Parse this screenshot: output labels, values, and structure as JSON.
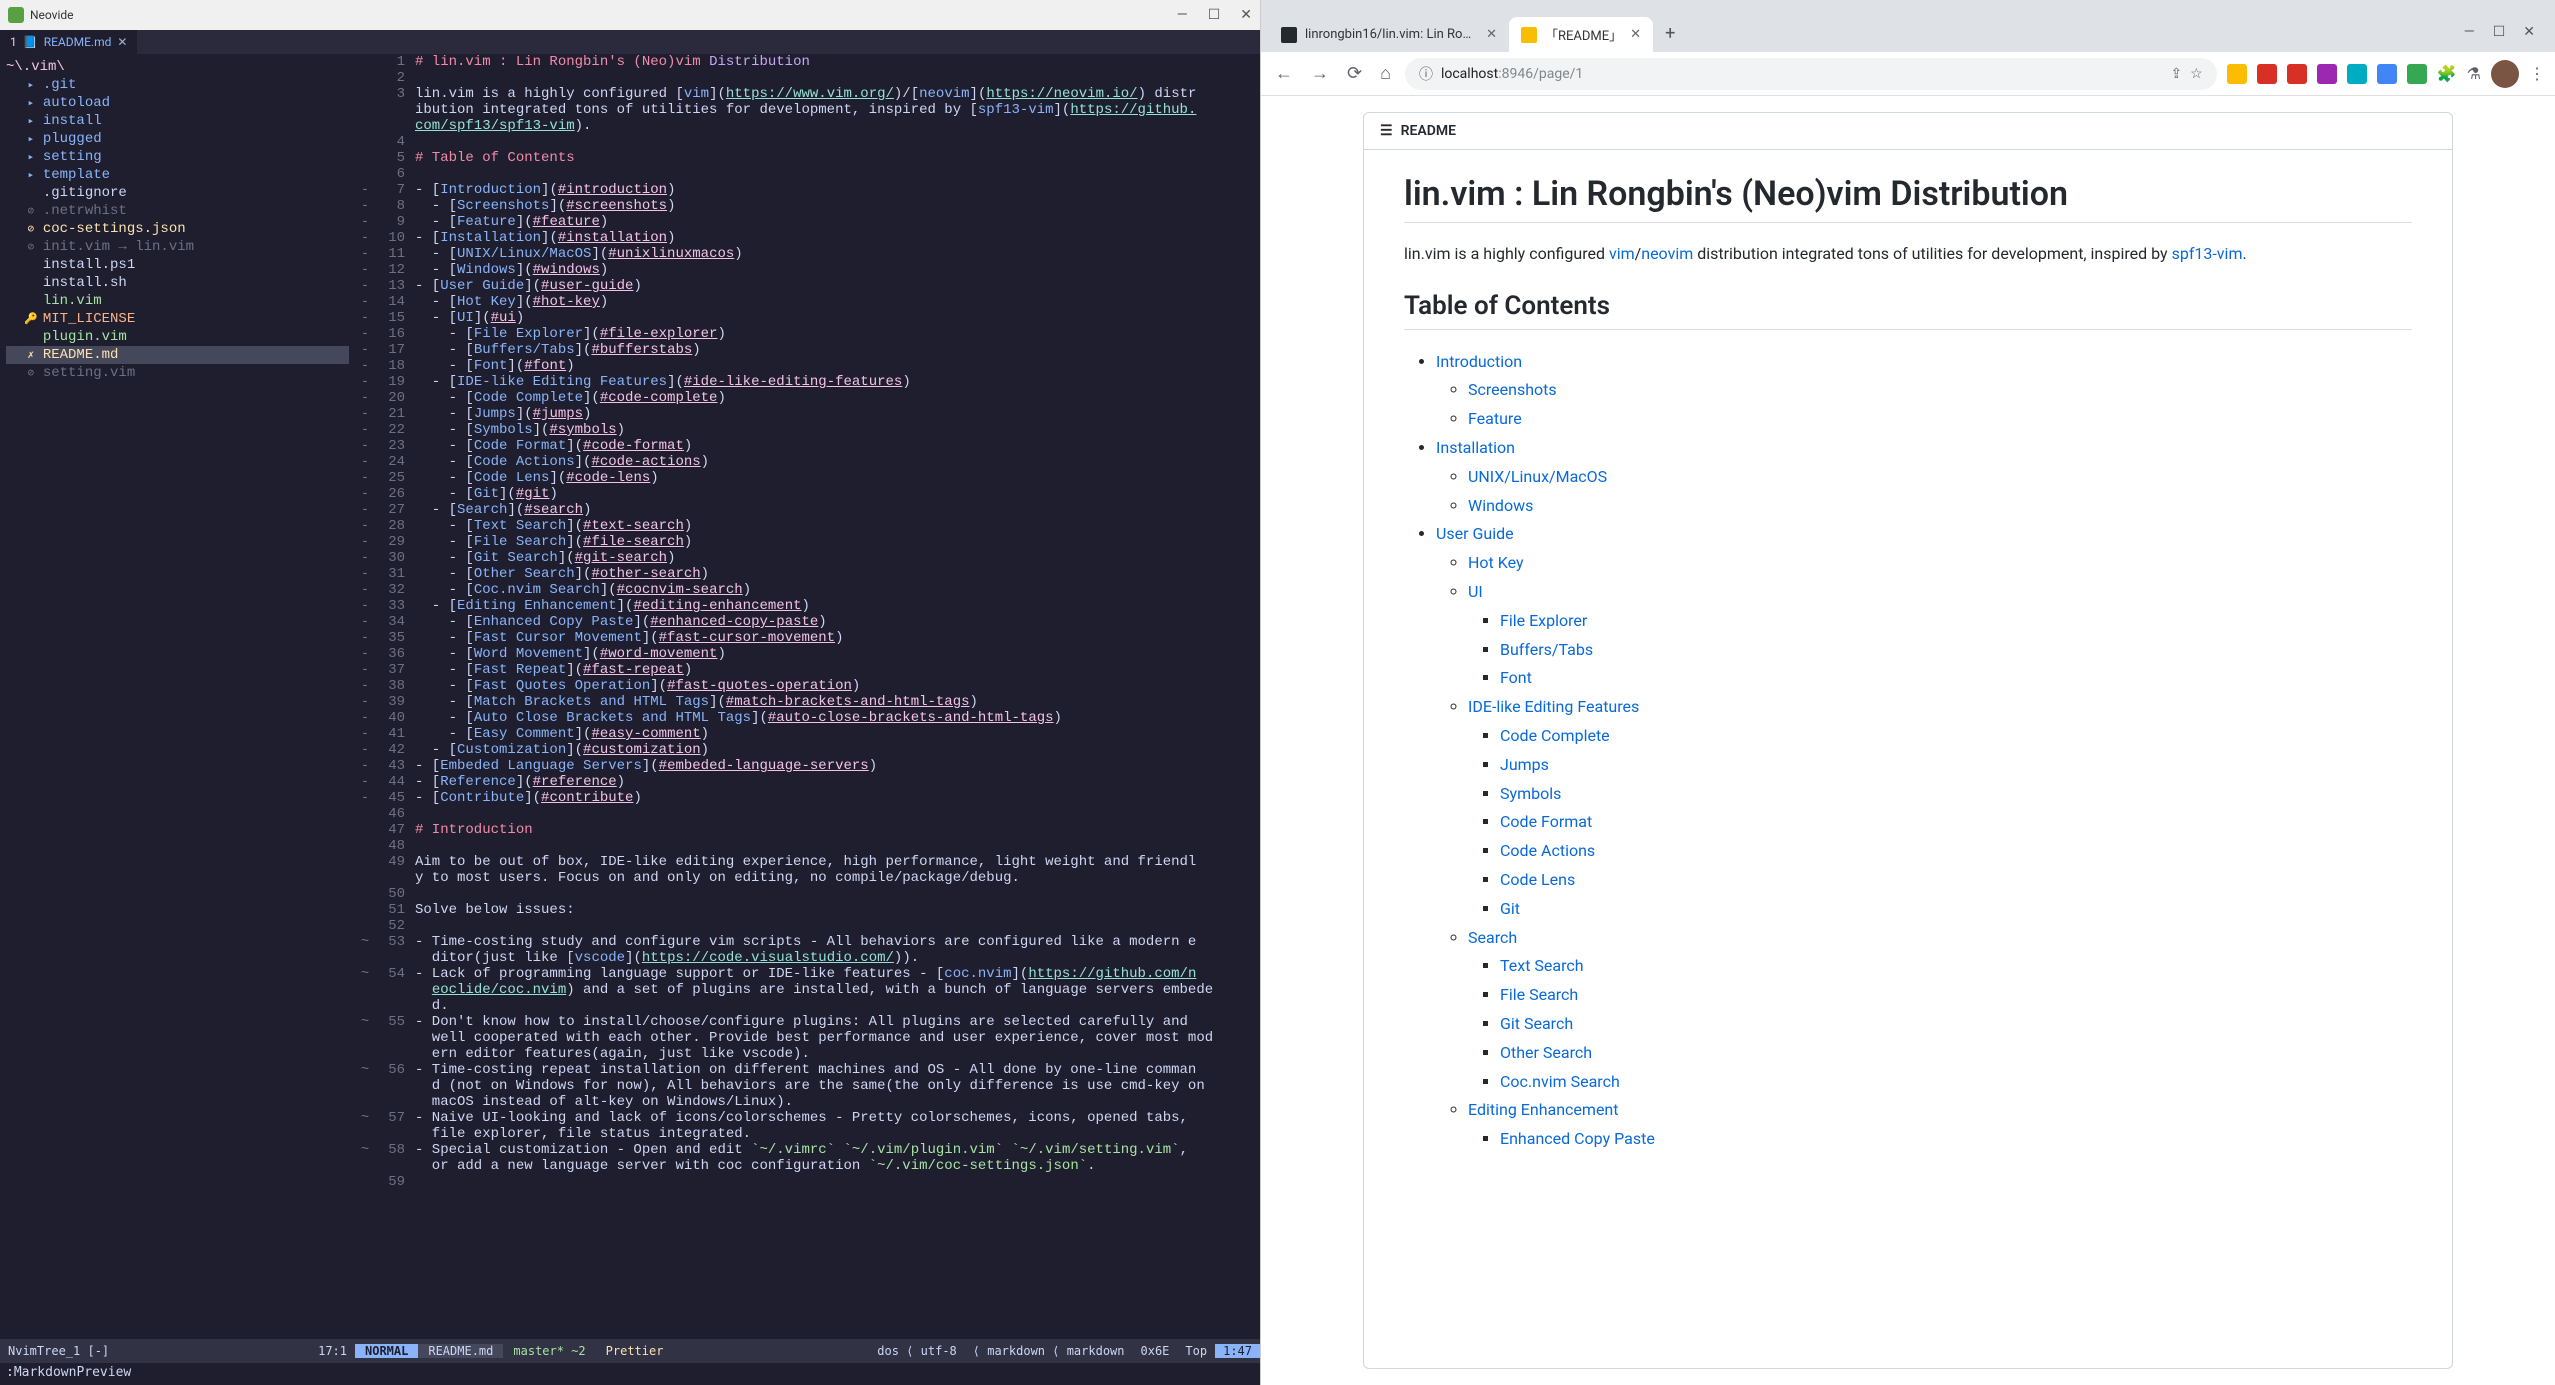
{
  "neovide": {
    "title": "Neovide",
    "tab": {
      "num": "1",
      "name": "README.md"
    },
    "tree": {
      "root": "~\\.vim\\",
      "items": [
        {
          "indent": 1,
          "icon": "▸",
          "name": ".git",
          "cls": "tree-folder"
        },
        {
          "indent": 1,
          "icon": "▸",
          "name": "autoload",
          "cls": "tree-folder"
        },
        {
          "indent": 1,
          "icon": "▸",
          "name": "install",
          "cls": "tree-folder"
        },
        {
          "indent": 1,
          "icon": "▸",
          "name": "plugged",
          "cls": "tree-folder"
        },
        {
          "indent": 1,
          "icon": "▸",
          "name": "setting",
          "cls": "tree-folder"
        },
        {
          "indent": 1,
          "icon": "▸",
          "name": "template",
          "cls": "tree-folder"
        },
        {
          "indent": 1,
          "icon": " ",
          "name": ".gitignore",
          "cls": "tree-file"
        },
        {
          "indent": 1,
          "icon": "⊘",
          "name": ".netrwhist",
          "cls": "tree-dim"
        },
        {
          "indent": 1,
          "icon": "⊘",
          "name": "coc-settings.json",
          "cls": "tree-json"
        },
        {
          "indent": 1,
          "icon": "⊘",
          "name": "init.vim → lin.vim",
          "cls": "tree-dim"
        },
        {
          "indent": 1,
          "icon": " ",
          "name": "install.ps1",
          "cls": "tree-file"
        },
        {
          "indent": 1,
          "icon": " ",
          "name": "install.sh",
          "cls": "tree-file"
        },
        {
          "indent": 1,
          "icon": " ",
          "name": "lin.vim",
          "cls": "tree-vim"
        },
        {
          "indent": 1,
          "icon": "🔑",
          "name": "MIT_LICENSE",
          "cls": "tree-license"
        },
        {
          "indent": 1,
          "icon": " ",
          "name": "plugin.vim",
          "cls": "tree-vim"
        },
        {
          "indent": 1,
          "icon": "✗",
          "name": "README.md",
          "cls": "tree-readme"
        },
        {
          "indent": 1,
          "icon": "⊘",
          "name": "setting.vim",
          "cls": "tree-dim"
        }
      ]
    },
    "tree_status": {
      "left": "NvimTree_1 [-]",
      "right": "17:1"
    },
    "status": {
      "mode": "NORMAL",
      "file": "README.md",
      "branch": " master* ~2",
      "prettier": "Prettier",
      "enc": "dos ⟨ utf-8",
      "ft": "⟨ markdown ⟨ markdown",
      "hex": "0x6E",
      "top": "Top",
      "time": "1:47"
    },
    "cmd": ":MarkdownPreview",
    "code": [
      {
        "n": 1,
        "s": "",
        "html": "<span class='md-hdr'># lin.vim : Lin Rongbin's (Neo)vim </span><span class='md-hl'>Distribution</span>"
      },
      {
        "n": 2,
        "s": "",
        "html": ""
      },
      {
        "n": 3,
        "s": "",
        "html": "lin.vim is a highly configured [<span class='md-link-text'>vim</span>](<span class='md-link-url'>https://www.vim.org/</span>)/[<span class='md-link-text'>neovim</span>](<span class='md-link-url'>https://neovim.io/</span>) distr"
      },
      {
        "n": "",
        "s": "",
        "html": "ibution integrated tons of utilities for development, inspired by [<span class='md-link-text'>spf13-vim</span>](<span class='md-link-url'>https://github.</span>"
      },
      {
        "n": "",
        "s": "",
        "html": "<span class='md-link-url'>com/spf13/spf13-vim</span>)."
      },
      {
        "n": 4,
        "s": "",
        "html": ""
      },
      {
        "n": 5,
        "s": "",
        "html": "<span class='md-hdr'># Table of Contents</span>"
      },
      {
        "n": 6,
        "s": "",
        "html": ""
      },
      {
        "n": 7,
        "s": "-",
        "html": "- [<span class='md-link-text'>Introduction</span>](<span class='md-link-anchor'>#introduction</span>)"
      },
      {
        "n": 8,
        "s": "-",
        "html": "  - [<span class='md-link-text'>Screenshots</span>](<span class='md-link-anchor'>#screenshots</span>)"
      },
      {
        "n": 9,
        "s": "-",
        "html": "  - [<span class='md-link-text'>Feature</span>](<span class='md-link-anchor'>#feature</span>)"
      },
      {
        "n": 10,
        "s": "-",
        "html": "- [<span class='md-link-text'>Installation</span>](<span class='md-link-anchor'>#installation</span>)"
      },
      {
        "n": 11,
        "s": "-",
        "html": "  - [<span class='md-link-text'>UNIX/Linux/MacOS</span>](<span class='md-link-anchor'>#unixlinuxmacos</span>)"
      },
      {
        "n": 12,
        "s": "-",
        "html": "  - [<span class='md-link-text'>Windows</span>](<span class='md-link-anchor'>#windows</span>)"
      },
      {
        "n": 13,
        "s": "-",
        "html": "- [<span class='md-link-text'>User Guide</span>](<span class='md-link-anchor'>#user-guide</span>)"
      },
      {
        "n": 14,
        "s": "-",
        "html": "  - [<span class='md-link-text'>Hot Key</span>](<span class='md-link-anchor'>#hot-key</span>)"
      },
      {
        "n": 15,
        "s": "-",
        "html": "  - [<span class='md-link-text'>UI</span>](<span class='md-link-anchor'>#ui</span>)"
      },
      {
        "n": 16,
        "s": "-",
        "html": "    - [<span class='md-link-text'>File Explorer</span>](<span class='md-link-anchor'>#file-explorer</span>)"
      },
      {
        "n": 17,
        "s": "-",
        "html": "    - [<span class='md-link-text'>Buffers/Tabs</span>](<span class='md-link-anchor'>#bufferstabs</span>)"
      },
      {
        "n": 18,
        "s": "-",
        "html": "    - [<span class='md-link-text'>Font</span>](<span class='md-link-anchor'>#font</span>)"
      },
      {
        "n": 19,
        "s": "-",
        "html": "  - [<span class='md-link-text'>IDE-like Editing Features</span>](<span class='md-link-anchor'>#ide-like-editing-features</span>)"
      },
      {
        "n": 20,
        "s": "-",
        "html": "    - [<span class='md-link-text'>Code Complete</span>](<span class='md-link-anchor'>#code-complete</span>)"
      },
      {
        "n": 21,
        "s": "-",
        "html": "    - [<span class='md-link-text'>Jumps</span>](<span class='md-link-anchor'>#jumps</span>)"
      },
      {
        "n": 22,
        "s": "-",
        "html": "    - [<span class='md-link-text'>Symbols</span>](<span class='md-link-anchor'>#symbols</span>)"
      },
      {
        "n": 23,
        "s": "-",
        "html": "    - [<span class='md-link-text'>Code Format</span>](<span class='md-link-anchor'>#code-format</span>)"
      },
      {
        "n": 24,
        "s": "-",
        "html": "    - [<span class='md-link-text'>Code Actions</span>](<span class='md-link-anchor'>#code-actions</span>)"
      },
      {
        "n": 25,
        "s": "-",
        "html": "    - [<span class='md-link-text'>Code Lens</span>](<span class='md-link-anchor'>#code-lens</span>)"
      },
      {
        "n": 26,
        "s": "-",
        "html": "    - [<span class='md-link-text'>Git</span>](<span class='md-link-anchor'>#git</span>)"
      },
      {
        "n": 27,
        "s": "-",
        "html": "  - [<span class='md-link-text'>Search</span>](<span class='md-link-anchor'>#search</span>)"
      },
      {
        "n": 28,
        "s": "-",
        "html": "    - [<span class='md-link-text'>Text Search</span>](<span class='md-link-anchor'>#text-search</span>)"
      },
      {
        "n": 29,
        "s": "-",
        "html": "    - [<span class='md-link-text'>File Search</span>](<span class='md-link-anchor'>#file-search</span>)"
      },
      {
        "n": 30,
        "s": "-",
        "html": "    - [<span class='md-link-text'>Git Search</span>](<span class='md-link-anchor'>#git-search</span>)"
      },
      {
        "n": 31,
        "s": "-",
        "html": "    - [<span class='md-link-text'>Other Search</span>](<span class='md-link-anchor'>#other-search</span>)"
      },
      {
        "n": 32,
        "s": "-",
        "html": "    - [<span class='md-link-text'>Coc.nvim Search</span>](<span class='md-link-anchor'>#cocnvim-search</span>)"
      },
      {
        "n": 33,
        "s": "-",
        "html": "  - [<span class='md-link-text'>Editing Enhancement</span>](<span class='md-link-anchor'>#editing-enhancement</span>)"
      },
      {
        "n": 34,
        "s": "-",
        "html": "    - [<span class='md-link-text'>Enhanced Copy Paste</span>](<span class='md-link-anchor'>#enhanced-copy-paste</span>)"
      },
      {
        "n": 35,
        "s": "-",
        "html": "    - [<span class='md-link-text'>Fast Cursor Movement</span>](<span class='md-link-anchor'>#fast-cursor-movement</span>)"
      },
      {
        "n": 36,
        "s": "-",
        "html": "    - [<span class='md-link-text'>Word Movement</span>](<span class='md-link-anchor'>#word-movement</span>)"
      },
      {
        "n": 37,
        "s": "-",
        "html": "    - [<span class='md-link-text'>Fast Repeat</span>](<span class='md-link-anchor'>#fast-repeat</span>)"
      },
      {
        "n": 38,
        "s": "-",
        "html": "    - [<span class='md-link-text'>Fast Quotes Operation</span>](<span class='md-link-anchor'>#fast-quotes-operation</span>)"
      },
      {
        "n": 39,
        "s": "-",
        "html": "    - [<span class='md-link-text'>Match Brackets and HTML Tags</span>](<span class='md-link-anchor'>#match-brackets-and-html-tags</span>)"
      },
      {
        "n": 40,
        "s": "-",
        "html": "    - [<span class='md-link-text'>Auto Close Brackets and HTML Tags</span>](<span class='md-link-anchor'>#auto-close-brackets-and-html-tags</span>)"
      },
      {
        "n": 41,
        "s": "-",
        "html": "    - [<span class='md-link-text'>Easy Comment</span>](<span class='md-link-anchor'>#easy-comment</span>)"
      },
      {
        "n": 42,
        "s": "-",
        "html": "  - [<span class='md-link-text'>Customization</span>](<span class='md-link-anchor'>#customization</span>)"
      },
      {
        "n": 43,
        "s": "-",
        "html": "- [<span class='md-link-text'>Embeded Language Servers</span>](<span class='md-link-anchor'>#embeded-language-servers</span>)"
      },
      {
        "n": 44,
        "s": "-",
        "html": "- [<span class='md-link-text'>Reference</span>](<span class='md-link-anchor'>#reference</span>)"
      },
      {
        "n": 45,
        "s": "-",
        "html": "- [<span class='md-link-text'>Contribute</span>](<span class='md-link-anchor'>#contribute</span>)"
      },
      {
        "n": 46,
        "s": "",
        "html": ""
      },
      {
        "n": 47,
        "s": "",
        "html": "<span class='md-hdr'># Introduction</span>"
      },
      {
        "n": 48,
        "s": "",
        "html": ""
      },
      {
        "n": 49,
        "s": "",
        "html": "Aim to be out of box, IDE-like editing experience, high performance, light weight and friendl"
      },
      {
        "n": "",
        "s": "",
        "html": "y to most users. Focus on and only on editing, no compile/package/debug."
      },
      {
        "n": 50,
        "s": "",
        "html": ""
      },
      {
        "n": 51,
        "s": "",
        "html": "Solve below issues:"
      },
      {
        "n": 52,
        "s": "",
        "html": ""
      },
      {
        "n": 53,
        "s": "~",
        "html": "- Time-costing study and configure vim scripts - All behaviors are configured like a modern e"
      },
      {
        "n": "",
        "s": "",
        "html": "  ditor(just like [<span class='md-link-text'>vscode</span>](<span class='md-link-url'>https://code.visualstudio.com/</span>))."
      },
      {
        "n": 54,
        "s": "~",
        "html": "- Lack of programming language support or IDE-like features - [<span class='md-link-text'>coc.nvim</span>](<span class='md-link-url'>https://github.com/n</span>"
      },
      {
        "n": "",
        "s": "",
        "html": "  <span class='md-link-url'>eoclide/coc.nvim</span>) and a set of plugins are installed, with a bunch of language servers embede"
      },
      {
        "n": "",
        "s": "",
        "html": "  d."
      },
      {
        "n": 55,
        "s": "~",
        "html": "- Don't know how to install/choose/configure plugins: All plugins are selected carefully and "
      },
      {
        "n": "",
        "s": "",
        "html": "  well cooperated with each other. Provide best performance and user experience, cover most mod"
      },
      {
        "n": "",
        "s": "",
        "html": "  ern editor features(again, just like vscode)."
      },
      {
        "n": 56,
        "s": "~",
        "html": "- Time-costing repeat installation on different machines and OS - All done by one-line comman"
      },
      {
        "n": "",
        "s": "",
        "html": "  d (not on Windows for now), All behaviors are the same(the only difference is use cmd-key on "
      },
      {
        "n": "",
        "s": "",
        "html": "  macOS instead of alt-key on Windows/Linux)."
      },
      {
        "n": 57,
        "s": "~",
        "html": "- Naive UI-looking and lack of icons/colorschemes - Pretty colorschemes, icons, opened tabs, "
      },
      {
        "n": "",
        "s": "",
        "html": "  file explorer, file status integrated."
      },
      {
        "n": 58,
        "s": "~",
        "html": "- Special customization - Open and edit <span class='md-code'>`~/.vimrc`</span> <span class='md-code'>`~/.vim/plugin.vim`</span> <span class='md-code'>`~/.vim/setting.vim`</span>, "
      },
      {
        "n": "",
        "s": "",
        "html": "  or add a new language server with coc configuration <span class='md-code'>`~/.vim/coc-settings.json`</span>."
      },
      {
        "n": 59,
        "s": "",
        "html": ""
      }
    ]
  },
  "browser": {
    "tabs": [
      {
        "title": "linrongbin16/lin.vim: Lin Rongbi...",
        "active": false,
        "favicon": "gh-icon"
      },
      {
        "title": "「README」",
        "active": true,
        "favicon": "doc-icon"
      }
    ],
    "url": {
      "host": "localhost",
      "port": ":8946",
      "path": "/page/1"
    },
    "readme": {
      "label": "README",
      "h1": "lin.vim : Lin Rongbin's (Neo)vim Distribution",
      "intro_pre": "lin.vim is a highly configured ",
      "intro_vim": "vim",
      "intro_slash": "/",
      "intro_neovim": "neovim",
      "intro_mid": " distribution integrated tons of utilities for development, inspired by ",
      "intro_spf13": "spf13-vim",
      "intro_end": ".",
      "h2": "Table of Contents",
      "toc": [
        {
          "text": "Introduction",
          "children": [
            {
              "text": "Screenshots"
            },
            {
              "text": "Feature"
            }
          ]
        },
        {
          "text": "Installation",
          "children": [
            {
              "text": "UNIX/Linux/MacOS"
            },
            {
              "text": "Windows"
            }
          ]
        },
        {
          "text": "User Guide",
          "children": [
            {
              "text": "Hot Key"
            },
            {
              "text": "UI",
              "children": [
                {
                  "text": "File Explorer"
                },
                {
                  "text": "Buffers/Tabs"
                },
                {
                  "text": "Font"
                }
              ]
            },
            {
              "text": "IDE-like Editing Features",
              "children": [
                {
                  "text": "Code Complete"
                },
                {
                  "text": "Jumps"
                },
                {
                  "text": "Symbols"
                },
                {
                  "text": "Code Format"
                },
                {
                  "text": "Code Actions"
                },
                {
                  "text": "Code Lens"
                },
                {
                  "text": "Git"
                }
              ]
            },
            {
              "text": "Search",
              "children": [
                {
                  "text": "Text Search"
                },
                {
                  "text": "File Search"
                },
                {
                  "text": "Git Search"
                },
                {
                  "text": "Other Search"
                },
                {
                  "text": "Coc.nvim Search"
                }
              ]
            },
            {
              "text": "Editing Enhancement",
              "children": [
                {
                  "text": "Enhanced Copy Paste"
                }
              ]
            }
          ]
        }
      ]
    }
  }
}
